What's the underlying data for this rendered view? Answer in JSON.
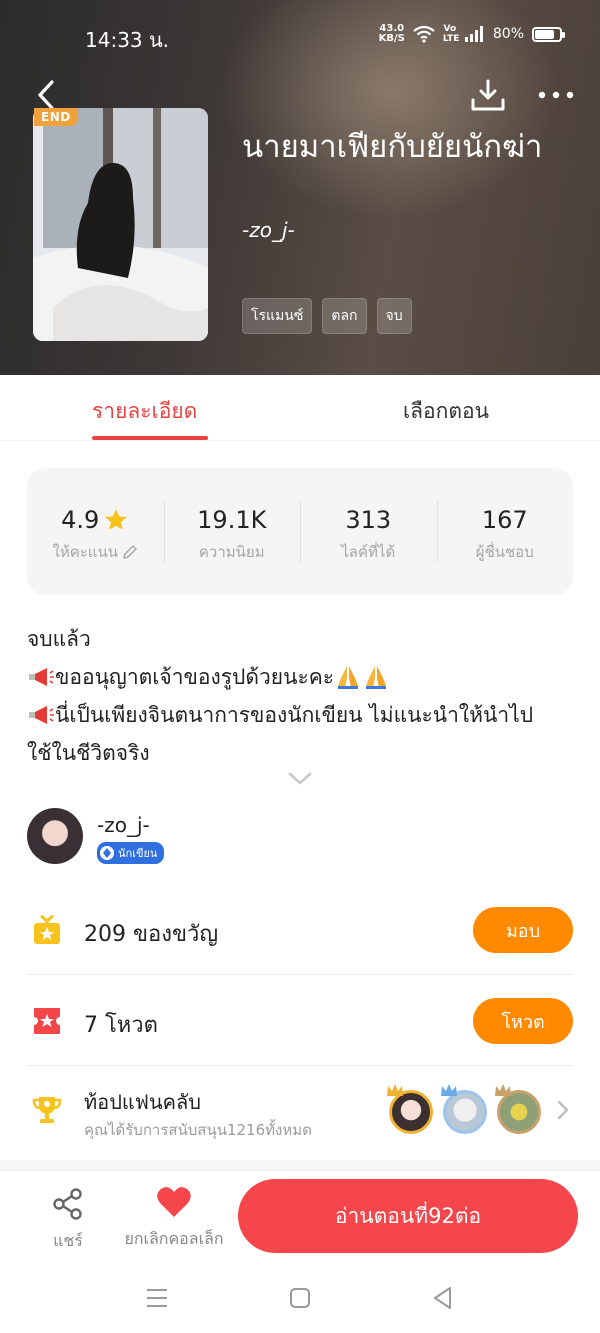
{
  "status_bar": {
    "time": "14:33 น.",
    "net_speed_value": "43.0",
    "net_speed_unit": "KB/S",
    "volte": "Vo LTE",
    "battery_percent": "80%",
    "battery_level": 0.8
  },
  "book": {
    "badge": "END",
    "title": "นายมาเฟียกับยัยนักฆ่า",
    "author": "-zo_j-",
    "tags": [
      "โรแมนซ์",
      "ตลก",
      "จบ"
    ]
  },
  "tabs": {
    "detail": "รายละเอียด",
    "episodes": "เลือกตอน"
  },
  "stats": [
    {
      "value": "4.9",
      "label": "ให้คะแนน"
    },
    {
      "value": "19.1K",
      "label": "ความนิยม"
    },
    {
      "value": "313",
      "label": "ไลค์ที่ได้"
    },
    {
      "value": "167",
      "label": "ผู้ชื่นชอบ"
    }
  ],
  "description": {
    "line1": "จบแล้ว",
    "line2": "ขออนุญาตเจ้าของรูปด้วยนะคะ",
    "line3": "นี่เป็นเพียงจินตนาการของนักเขียน ไม่แนะนำให้นำไป",
    "line4": "ใช้ในชีวิตจริง"
  },
  "author": {
    "name": "-zo_j-",
    "badge": "นักเขียน"
  },
  "gifts": {
    "text": "209 ของขวัญ",
    "button": "มอบ"
  },
  "votes": {
    "text": "7 โหวต",
    "button": "โหวต"
  },
  "fanclub": {
    "title": "ท้อปแฟนคลับ",
    "subtitle": "คุณได้รับการสนับสนุน1216ทั้งหมด"
  },
  "bottom_bar": {
    "share": "แชร์",
    "unfavorite": "ยกเลิกคอลเล็ก",
    "read_button": "อ่านตอนที่92ต่อ"
  },
  "colors": {
    "accent_red": "#f5474b",
    "tab_red": "#e94444",
    "orange": "#ff8a00",
    "gift_yellow": "#f8c21c",
    "vote_red": "#f4454b"
  }
}
